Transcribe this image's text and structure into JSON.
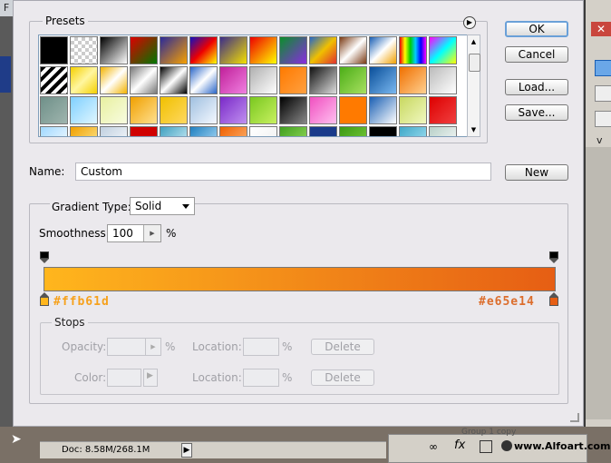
{
  "background": {
    "left_title": "F",
    "right_text": "v",
    "status_doc": "Doc: 8.58M/268.1M",
    "status_arrow": "▶",
    "watermark": "www.Alfoart.com",
    "layers_fx": "fx",
    "layers_group": "Group 1 copy"
  },
  "presets": {
    "label": "Presets",
    "swatches": [
      "#000000",
      "repeating-conic-gradient(#ccc 0 25%,#fff 0 50%) 0 0/8px 8px",
      "linear-gradient(135deg,#000,#fff)",
      "linear-gradient(135deg,#d00,#070)",
      "linear-gradient(135deg,#2a2a9a,#f7a000)",
      "linear-gradient(135deg,#1010c0,#e00,#ff0)",
      "linear-gradient(135deg,#3b2c8a,#f5e000)",
      "linear-gradient(135deg,#e00,#ff0)",
      "linear-gradient(135deg,#0a8f2a,#8a2be2)",
      "linear-gradient(135deg,#2468c8,#f0c000,#e03030)",
      "linear-gradient(135deg,#7a3a14,#fff,#7a3a14)",
      "linear-gradient(135deg,#1a5fb4,#fff,#f0a000)",
      "linear-gradient(90deg,#e00,#ff0,#0c0,#0cf,#00f,#f0f)",
      "linear-gradient(135deg,#f0f,#0ff,#ff0)",
      "repeating-linear-gradient(135deg,#000 0 4px,#fff 4px 8px)",
      "linear-gradient(135deg,#f5d000,#fff6a0,#f5d000)",
      "linear-gradient(135deg,#f3b300,#fff,#f3b300)",
      "linear-gradient(135deg,#777,#fff,#777)",
      "linear-gradient(135deg,#000,#fff,#000)",
      "linear-gradient(135deg,#2a66c8,#fff,#2a66c8)",
      "linear-gradient(135deg,#c0209a,#f080e0)",
      "linear-gradient(135deg,#b0b0b0,#fff)",
      "linear-gradient(135deg,#ff7a00,#ffa040)",
      "linear-gradient(135deg,#111,#ddd)",
      "linear-gradient(135deg,#4cae18,#a8e060)",
      "linear-gradient(135deg,#0a4f9a,#7ab8f0)",
      "linear-gradient(135deg,#f07000,#ffd090)",
      "linear-gradient(135deg,#bbb,#fff)",
      "linear-gradient(135deg,#6f9089,#9fb5ae)",
      "linear-gradient(135deg,#7fd0ff,#e0f6ff)",
      "linear-gradient(135deg,#e8f0a0,#f8fce0)",
      "linear-gradient(135deg,#f0a000,#ffe090)",
      "linear-gradient(135deg,#f0c000,#ffd860)",
      "linear-gradient(135deg,#a0c0e0,#f4f8ff)",
      "linear-gradient(135deg,#7a2ac8,#c090f0)",
      "linear-gradient(135deg,#7ac820,#c8f060)",
      "linear-gradient(135deg,#000,#888)",
      "linear-gradient(135deg,#f050c0,#ffc0f0)",
      "linear-gradient(135deg,#ff7a00,#ff7a00)",
      "linear-gradient(135deg,#1a5fb4,#fff)",
      "linear-gradient(135deg,#c8d860,#f0f8c0)",
      "linear-gradient(135deg,#d00,#f04040)",
      "linear-gradient(135deg,#a0d8ff,#fff)",
      "linear-gradient(135deg,#f0a000,#fff0a0)",
      "linear-gradient(135deg,#c0d0e0,#fff)",
      "#d00000",
      "linear-gradient(135deg,#40a0c0,#e0f8ff)",
      "linear-gradient(135deg,#2080c0,#c0e8ff)",
      "linear-gradient(135deg,#f06000,#ffc080)",
      "linear-gradient(135deg,#fff,#eee)",
      "linear-gradient(135deg,#40a020,#a0e060)",
      "#1a3a8a",
      "linear-gradient(135deg,#3c9a14,#80d040)",
      "#000000",
      "linear-gradient(135deg,#40a8c8,#b0e8f8)",
      "linear-gradient(135deg,#b8d0c8,#fff)"
    ]
  },
  "buttons": {
    "ok": "OK",
    "cancel": "Cancel",
    "load": "Load...",
    "save": "Save...",
    "new": "New"
  },
  "name": {
    "label": "Name:",
    "value": "Custom"
  },
  "gradient": {
    "type_label": "Gradient Type:",
    "type_value": "Solid",
    "smoothness_label": "Smoothness:",
    "smoothness_value": "100",
    "smoothness_unit": "%",
    "left_color": "#ffb61d",
    "right_color": "#e65e14",
    "left_hex_label": "#ffb61d",
    "right_hex_label": "#e65e14"
  },
  "stops": {
    "label": "Stops",
    "opacity_label": "Opacity:",
    "opacity_unit": "%",
    "location_label": "Location:",
    "location_unit": "%",
    "delete_label": "Delete",
    "color_label": "Color:",
    "location2_label": "Location:",
    "location2_unit": "%",
    "delete2_label": "Delete"
  }
}
